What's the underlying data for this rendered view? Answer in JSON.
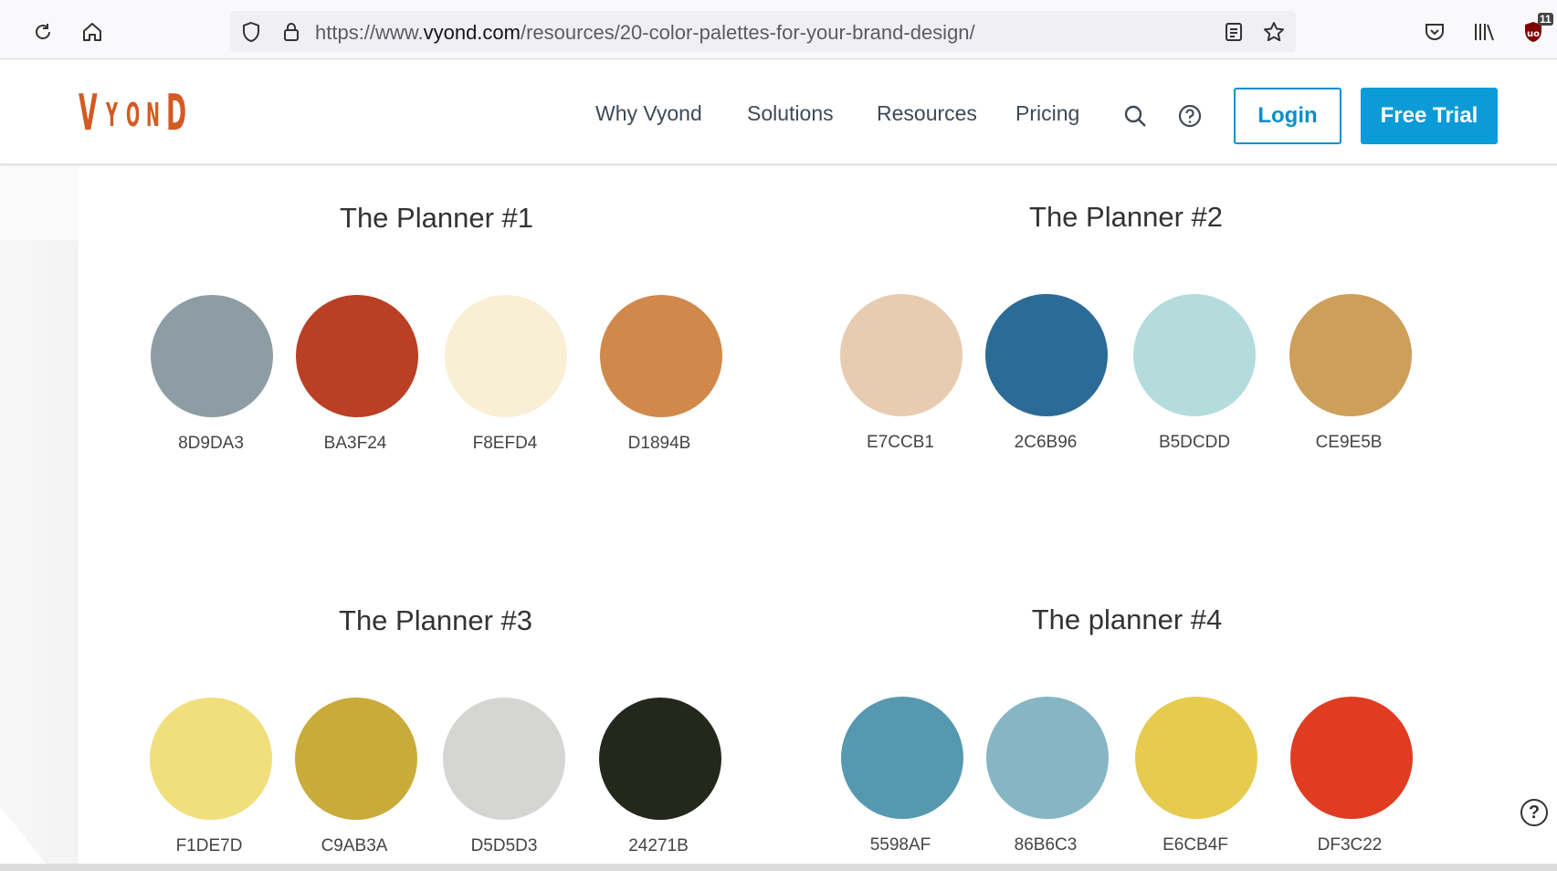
{
  "browser": {
    "url_prefix": "https://www.",
    "url_host": "vyond.com",
    "url_path": "/resources/20-color-palettes-for-your-brand-design/",
    "extension_badge": "11"
  },
  "site": {
    "logo": [
      "V",
      "Y",
      "O",
      "N",
      "D"
    ],
    "brand_color": "#d35a22",
    "nav": [
      "Why Vyond",
      "Solutions",
      "Resources",
      "Pricing"
    ],
    "login_label": "Login",
    "trial_label": "Free Trial",
    "accent_color": "#0b9bd7"
  },
  "palettes": [
    {
      "title": "The Planner #1",
      "colors": [
        {
          "label": "8D9DA3",
          "hex": "#8d9da3"
        },
        {
          "label": "BA3F24",
          "hex": "#ba3f24"
        },
        {
          "label": "F8EFD4",
          "hex": "#f8efd4"
        },
        {
          "label": "D1894B",
          "hex": "#d1894b"
        }
      ]
    },
    {
      "title": "The Planner #2",
      "colors": [
        {
          "label": "E7CCB1",
          "hex": "#e7ccb1"
        },
        {
          "label": "2C6B96",
          "hex": "#2c6b96"
        },
        {
          "label": "B5DCDD",
          "hex": "#b5dcdd"
        },
        {
          "label": "CE9E5B",
          "hex": "#ce9e5b"
        }
      ]
    },
    {
      "title": "The Planner #3",
      "colors": [
        {
          "label": "F1DE7D",
          "hex": "#f1de7d"
        },
        {
          "label": "C9AB3A",
          "hex": "#c9ab3a"
        },
        {
          "label": "D5D5D3",
          "hex": "#d5d5d3"
        },
        {
          "label": "24271B",
          "hex": "#24271b"
        }
      ]
    },
    {
      "title": "The planner #4",
      "colors": [
        {
          "label": "5598AF",
          "hex": "#5598af"
        },
        {
          "label": "86B6C3",
          "hex": "#86b6c3"
        },
        {
          "label": "E6CB4F",
          "hex": "#e6cb4f"
        },
        {
          "label": "DF3C22",
          "hex": "#df3c22"
        }
      ]
    }
  ],
  "help_glyph": "?"
}
